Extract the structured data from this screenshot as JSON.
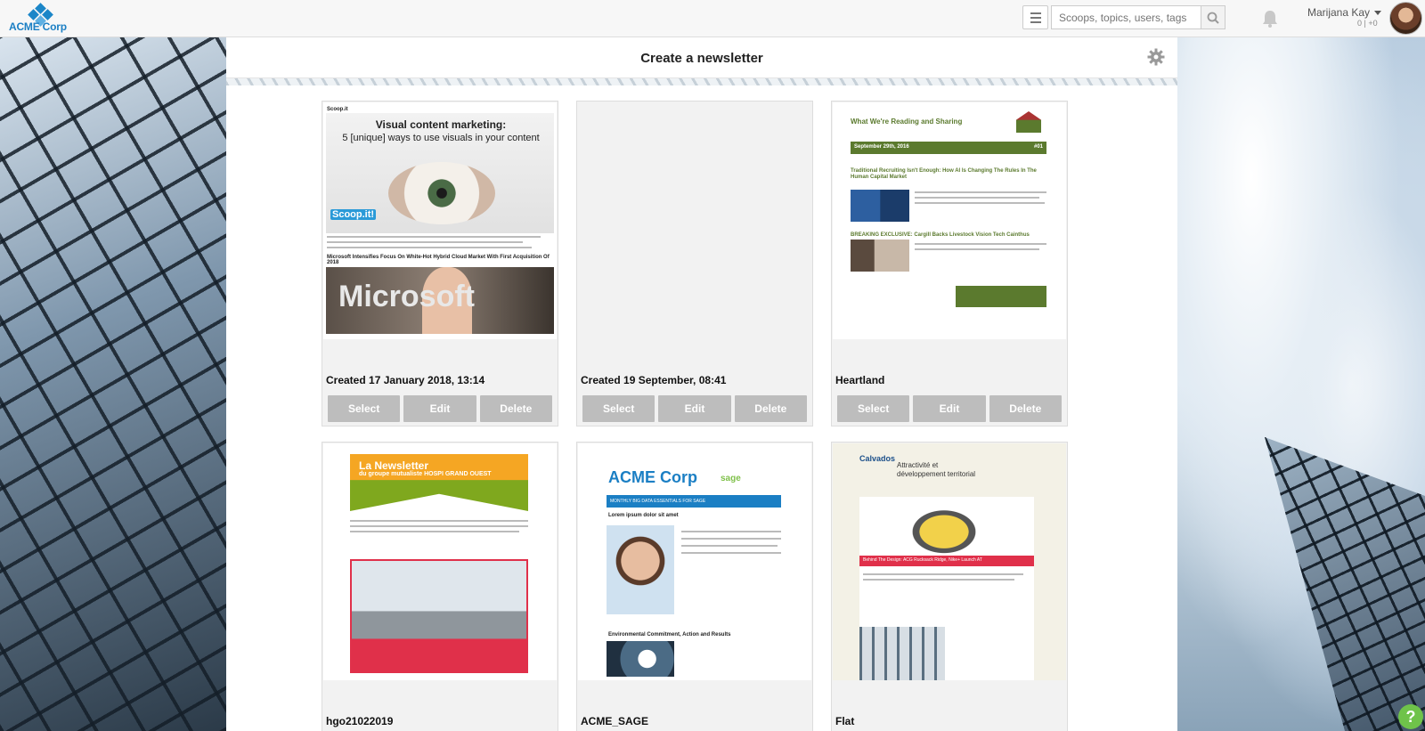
{
  "app": {
    "logo_text": "ACME Corp",
    "brand_color": "#1b7fc4"
  },
  "header": {
    "search_placeholder": "Scoops, topics, users, tags",
    "menu_icon": "hamburger-icon",
    "search_icon": "magnifier-icon",
    "notification_icon": "bell-icon",
    "user_name": "Marijana Kay",
    "user_score": "0 | +0"
  },
  "panel": {
    "title": "Create a newsletter",
    "settings_icon": "gear-icon"
  },
  "buttons": {
    "select": "Select",
    "edit": "Edit",
    "delete": "Delete"
  },
  "templates": [
    {
      "label": "Created 17 January 2018, 13:14",
      "preview": {
        "brand": "Scoop.it",
        "headline": "Visual content marketing:",
        "subheadline": "5 [unique] ways to use visuals in your content",
        "logo": "Scoop.it!",
        "second_headline": "Microsoft Intensifies Focus On White-Hot Hybrid Cloud Market With First Acquisition Of 2018",
        "image_text": "Microsoft"
      }
    },
    {
      "label": "Created 19 September, 08:41"
    },
    {
      "label": "Heartland",
      "preview": {
        "title": "What We're Reading and Sharing",
        "date": "September 29th, 2016",
        "issue": "#01",
        "headline1": "Traditional Recruiting Isn't Enough: How AI Is Changing The Rules In The Human Capital Market",
        "headline2": "BREAKING EXCLUSIVE: Cargill Backs Livestock Vision Tech Cainthus"
      }
    },
    {
      "label": "hgo21022019",
      "preview": {
        "title": "La Newsletter",
        "subtitle": "du groupe mutualiste HOSPI GRAND OUEST"
      }
    },
    {
      "label": "ACME_SAGE",
      "preview": {
        "logo": "ACME Corp",
        "partner": "sage",
        "bar": "MONTHLY BIG DATA ESSENTIALS FOR SAGE",
        "headline": "Lorem ipsum dolor sit amet",
        "headline2": "Environmental Commitment, Action and Results"
      }
    },
    {
      "label": "Flat",
      "preview": {
        "logo": "Calvados",
        "tagline": "Attractivité et développement territorial",
        "headline": "Behind The Design: ACG Rucksack Ridge, Nike+ Launch AT"
      }
    }
  ],
  "help": {
    "label": "?"
  }
}
